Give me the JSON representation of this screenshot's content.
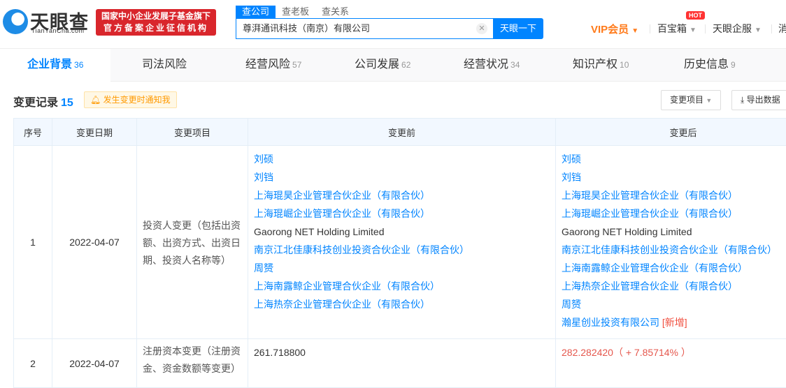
{
  "header": {
    "logo_text": "天眼查",
    "logo_sub": "TianYanCha.com",
    "badge_line1": "国家中小企业发展子基金旗下",
    "badge_line2": "官方备案企业征信机构",
    "search_tabs": [
      "查公司",
      "查老板",
      "查关系"
    ],
    "search_value": "尊湃通讯科技（南京）有限公司",
    "search_button": "天眼一下",
    "nav": {
      "vip": "VIP会员",
      "treasure": "百宝箱",
      "hot": "HOT",
      "enterprise": "天眼企服",
      "msg": "消"
    }
  },
  "tabs": [
    {
      "label": "企业背景",
      "count": "36"
    },
    {
      "label": "司法风险",
      "count": ""
    },
    {
      "label": "经营风险",
      "count": "57"
    },
    {
      "label": "公司发展",
      "count": "62"
    },
    {
      "label": "经营状况",
      "count": "34"
    },
    {
      "label": "知识产权",
      "count": "10"
    },
    {
      "label": "历史信息",
      "count": "9"
    }
  ],
  "section": {
    "title": "变更记录",
    "count": "15",
    "notify": "发生变更时通知我",
    "filter": "变更项目",
    "export": "导出数据"
  },
  "table": {
    "columns": [
      "序号",
      "变更日期",
      "变更项目",
      "变更前",
      "变更后"
    ],
    "rows": [
      {
        "no": "1",
        "date": "2022-04-07",
        "item": "投资人变更（包括出资额、出资方式、出资日期、投资人名称等）",
        "before": [
          {
            "t": "刘硕",
            "link": true
          },
          {
            "t": "刘铛",
            "link": true
          },
          {
            "t": "上海琨昊企业管理合伙企业（有限合伙）",
            "link": true
          },
          {
            "t": "上海琨崛企业管理合伙企业（有限合伙）",
            "link": true
          },
          {
            "t": "Gaorong NET Holding Limited",
            "link": false
          },
          {
            "t": "南京江北佳康科技创业投资合伙企业（有限合伙）",
            "link": true
          },
          {
            "t": "周赟",
            "link": true
          },
          {
            "t": "上海南露鲸企业管理合伙企业（有限合伙）",
            "link": true
          },
          {
            "t": "上海热奈企业管理合伙企业（有限合伙）",
            "link": true
          }
        ],
        "after": [
          {
            "t": "刘硕",
            "link": true
          },
          {
            "t": "刘铛",
            "link": true
          },
          {
            "t": "上海琨昊企业管理合伙企业（有限合伙）",
            "link": true
          },
          {
            "t": "上海琨崛企业管理合伙企业（有限合伙）",
            "link": true
          },
          {
            "t": "Gaorong NET Holding Limited",
            "link": false
          },
          {
            "t": "南京江北佳康科技创业投资合伙企业（有限合伙）",
            "link": true
          },
          {
            "t": "上海南露鲸企业管理合伙企业（有限合伙）",
            "link": true
          },
          {
            "t": "上海热奈企业管理合伙企业（有限合伙）",
            "link": true
          },
          {
            "t": "周赟",
            "link": true
          },
          {
            "t": "瀚星创业投资有限公司",
            "link": true,
            "tag": "[新增]"
          }
        ]
      },
      {
        "no": "2",
        "date": "2022-04-07",
        "item": "注册资本变更（注册资金、资金数额等变更）",
        "before_text": "261.718800",
        "after_text": "282.282420（ + 7.85714% ）"
      }
    ]
  },
  "colors": {
    "accent": "#0084ff",
    "vip": "#ff7a1a",
    "badge": "#d9262c",
    "increase": "#e5574d"
  }
}
